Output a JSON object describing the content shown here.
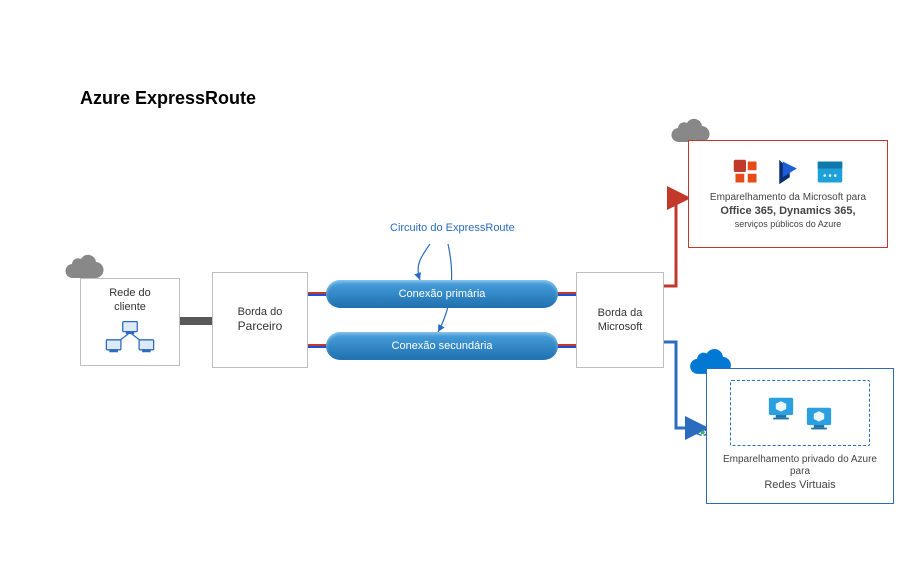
{
  "title": "Azure ExpressRoute",
  "client": {
    "label_line1": "Rede do",
    "label_line2": "cliente"
  },
  "partner": {
    "label_line1": "Borda do",
    "label_line2": "Parceiro"
  },
  "msedge": {
    "label_line1": "Borda da",
    "label_line2": "Microsoft"
  },
  "circuit_label": "Circuito do ExpressRoute",
  "pipes": {
    "primary": "Conexão primária",
    "secondary": "Conexão secundária"
  },
  "ms_peering": {
    "line1": "Emparelhamento da Microsoft para",
    "line2_bold": "Office 365, Dynamics 365,",
    "line3": "serviços públicos do Azure"
  },
  "az_peering": {
    "line1": "Emparelhamento privado do Azure para",
    "line2": "Redes Virtuais"
  },
  "icons": {
    "cloud_client": "cloud-icon",
    "cloud_ms": "cloud-icon",
    "cloud_az": "cloud-icon",
    "office": "office-icon",
    "dynamics": "dynamics-icon",
    "browser": "browser-icon",
    "vm": "vm-icon",
    "network": "network-icon"
  },
  "colors": {
    "ms_border": "#c0392b",
    "az_border": "#2c6cbf",
    "pipe_blue": "#1f6fae",
    "cloud_gray": "#888888",
    "cloud_blue": "#0078d4"
  }
}
